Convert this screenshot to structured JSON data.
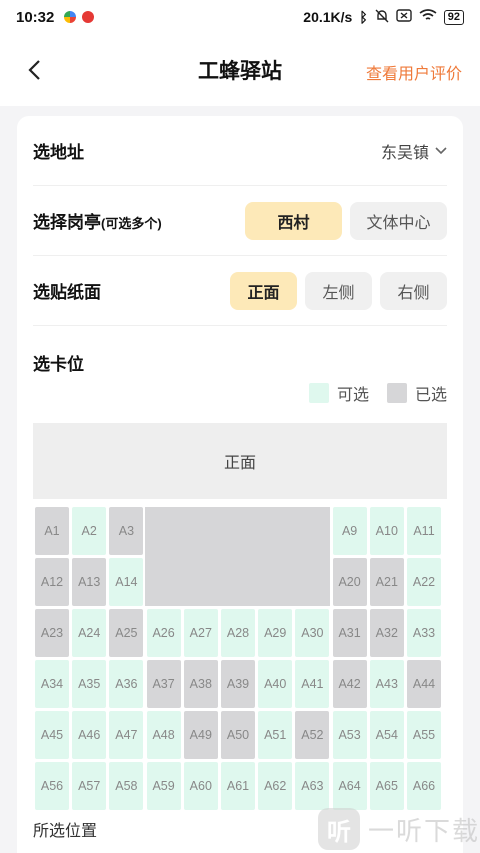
{
  "status_bar": {
    "time": "10:32",
    "network_speed": "20.1K/s",
    "battery": "92"
  },
  "nav": {
    "title": "工蜂驿站",
    "action": "查看用户评价"
  },
  "address": {
    "label": "选地址",
    "value": "东吴镇"
  },
  "kiosk": {
    "label": "选择岗亭",
    "hint": "(可选多个)",
    "options": [
      "西村",
      "文体中心"
    ],
    "selected": "西村"
  },
  "side": {
    "label": "选贴纸面",
    "options": [
      "正面",
      "左侧",
      "右侧"
    ],
    "selected": "正面"
  },
  "seats": {
    "title": "选卡位",
    "legend": {
      "available": "可选",
      "taken": "已选"
    },
    "front_label": "正面",
    "colors": {
      "available": "#dff8ee",
      "taken": "#d6d6d8"
    },
    "rows": [
      [
        {
          "id": "A1",
          "s": "taken"
        },
        {
          "id": "A2",
          "s": "avail"
        },
        {
          "id": "A3",
          "s": "taken"
        },
        null,
        null,
        null,
        null,
        null,
        {
          "id": "A9",
          "s": "avail"
        },
        {
          "id": "A10",
          "s": "avail"
        },
        {
          "id": "A11",
          "s": "avail"
        }
      ],
      [
        {
          "id": "A12",
          "s": "taken"
        },
        {
          "id": "A13",
          "s": "taken"
        },
        {
          "id": "A14",
          "s": "avail"
        },
        null,
        null,
        null,
        null,
        null,
        {
          "id": "A20",
          "s": "taken"
        },
        {
          "id": "A21",
          "s": "taken"
        },
        {
          "id": "A22",
          "s": "avail"
        }
      ],
      [
        {
          "id": "A23",
          "s": "taken"
        },
        {
          "id": "A24",
          "s": "avail"
        },
        {
          "id": "A25",
          "s": "taken"
        },
        {
          "id": "A26",
          "s": "avail"
        },
        {
          "id": "A27",
          "s": "avail"
        },
        {
          "id": "A28",
          "s": "avail"
        },
        {
          "id": "A29",
          "s": "avail"
        },
        {
          "id": "A30",
          "s": "avail"
        },
        {
          "id": "A31",
          "s": "taken"
        },
        {
          "id": "A32",
          "s": "taken"
        },
        {
          "id": "A33",
          "s": "avail"
        }
      ],
      [
        {
          "id": "A34",
          "s": "avail"
        },
        {
          "id": "A35",
          "s": "avail"
        },
        {
          "id": "A36",
          "s": "avail"
        },
        {
          "id": "A37",
          "s": "taken"
        },
        {
          "id": "A38",
          "s": "taken"
        },
        {
          "id": "A39",
          "s": "taken"
        },
        {
          "id": "A40",
          "s": "avail"
        },
        {
          "id": "A41",
          "s": "avail"
        },
        {
          "id": "A42",
          "s": "taken"
        },
        {
          "id": "A43",
          "s": "avail"
        },
        {
          "id": "A44",
          "s": "taken"
        }
      ],
      [
        {
          "id": "A45",
          "s": "avail"
        },
        {
          "id": "A46",
          "s": "avail"
        },
        {
          "id": "A47",
          "s": "avail"
        },
        {
          "id": "A48",
          "s": "avail"
        },
        {
          "id": "A49",
          "s": "taken"
        },
        {
          "id": "A50",
          "s": "taken"
        },
        {
          "id": "A51",
          "s": "avail"
        },
        {
          "id": "A52",
          "s": "taken"
        },
        {
          "id": "A53",
          "s": "avail"
        },
        {
          "id": "A54",
          "s": "avail"
        },
        {
          "id": "A55",
          "s": "avail"
        }
      ],
      [
        {
          "id": "A56",
          "s": "avail"
        },
        {
          "id": "A57",
          "s": "avail"
        },
        {
          "id": "A58",
          "s": "avail"
        },
        {
          "id": "A59",
          "s": "avail"
        },
        {
          "id": "A60",
          "s": "avail"
        },
        {
          "id": "A61",
          "s": "avail"
        },
        {
          "id": "A62",
          "s": "avail"
        },
        {
          "id": "A63",
          "s": "avail"
        },
        {
          "id": "A64",
          "s": "avail"
        },
        {
          "id": "A65",
          "s": "avail"
        },
        {
          "id": "A66",
          "s": "avail"
        }
      ]
    ]
  },
  "selected_position_label": "所选位置",
  "watermark": {
    "logo": "听",
    "text": "一听下载"
  },
  "accent_color": "#ef7a3a"
}
